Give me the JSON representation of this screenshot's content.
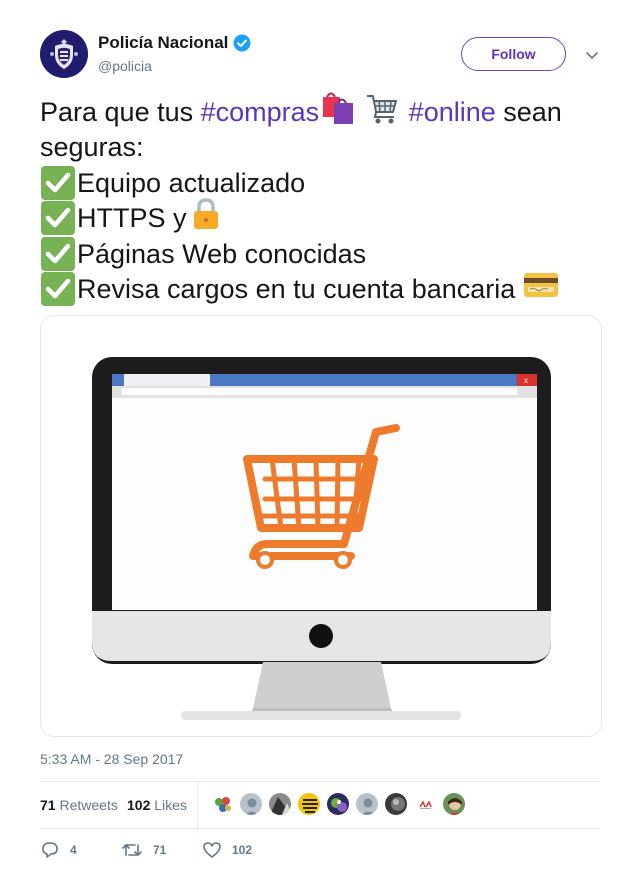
{
  "author": {
    "display_name": "Policía Nacional",
    "handle": "@policia",
    "verified": true
  },
  "follow_button": {
    "label": "Follow"
  },
  "tweet": {
    "line1": {
      "prefix": "Para que tus ",
      "hashtag1": "#compras",
      "hashtag2": "#online",
      "suffix": " sean"
    },
    "line2": "seguras:",
    "items": [
      "Equipo actualizado",
      "HTTPS y",
      "Páginas Web conocidas",
      "Revisa cargos en tu cuenta bancaria"
    ],
    "emojis": [
      "shopping-bags-emoji",
      "shopping-cart-emoji",
      "check-mark-emoji",
      "lock-emoji",
      "credit-card-emoji"
    ]
  },
  "media": {
    "image_label": "browser-window-x",
    "close_glyph": "x"
  },
  "timestamp": "5:33 AM - 28 Sep 2017",
  "stats": {
    "retweets_count": "71",
    "retweets_label": "Retweets",
    "likes_count": "102",
    "likes_label": "Likes"
  },
  "actions": {
    "replies": "4",
    "retweets": "71",
    "likes": "102"
  },
  "colors": {
    "accent": "#5b35c0",
    "text": "#14171a",
    "muted": "#657786",
    "border": "#e1e8ed",
    "cart": "#ee7a2b"
  }
}
